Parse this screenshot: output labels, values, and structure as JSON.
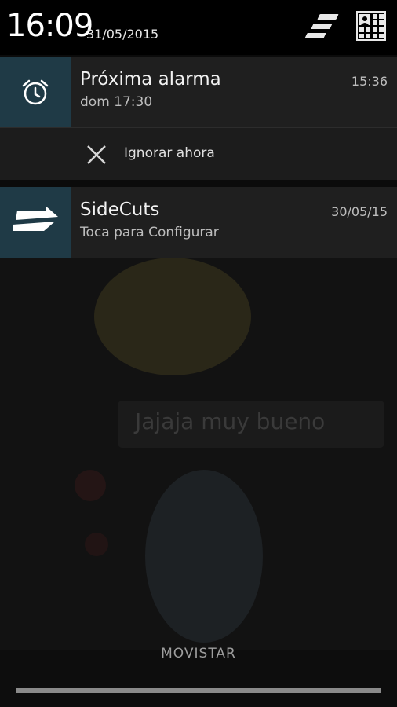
{
  "header": {
    "time": "16:09",
    "date": "31/05/2015"
  },
  "notifications": [
    {
      "title": "Próxima alarma",
      "subtitle": "dom 17:30",
      "time": "15:36",
      "icon": "alarm-clock-icon",
      "action": {
        "label": "Ignorar ahora",
        "icon": "close-icon"
      }
    },
    {
      "title": "SideCuts",
      "subtitle": "Toca para Configurar",
      "time": "30/05/15",
      "icon": "sidecuts-arrow-icon"
    }
  ],
  "wallpaper": {
    "caption": "Jajaja muy bueno"
  },
  "footer": {
    "carrier": "MOVISTAR"
  },
  "colors": {
    "icon_tile": "#1f3a46",
    "card_bg": "#1f1f1f"
  }
}
